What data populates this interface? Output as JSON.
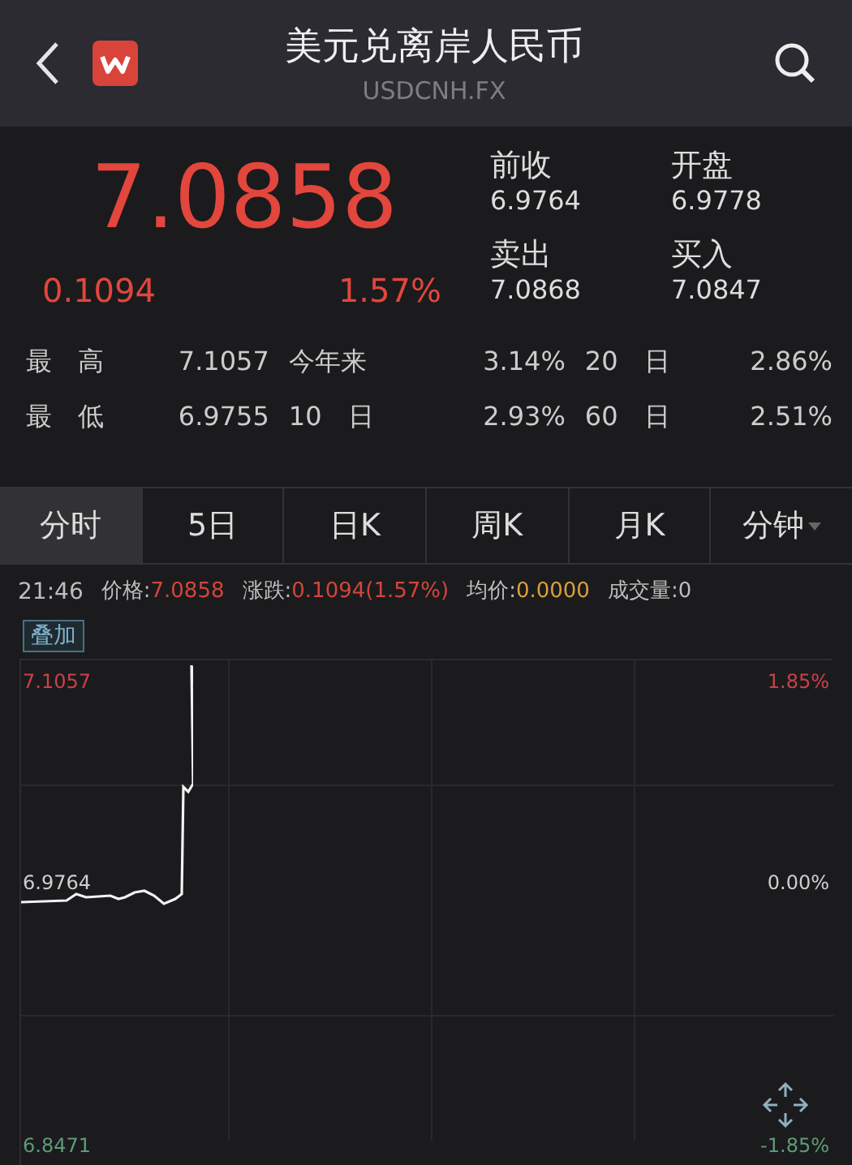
{
  "header": {
    "title": "美元兑离岸人民币",
    "subtitle": "USDCNH.FX"
  },
  "quote": {
    "price": "7.0858",
    "change": "0.1094",
    "change_pct": "1.57%",
    "fields": [
      {
        "label": "前收",
        "value": "6.9764"
      },
      {
        "label": "开盘",
        "value": "6.9778"
      },
      {
        "label": "卖出",
        "value": "7.0868"
      },
      {
        "label": "买入",
        "value": "7.0847"
      }
    ]
  },
  "stats": [
    [
      {
        "label": "最　高",
        "value": "7.1057"
      },
      {
        "label": "今年来",
        "value": "3.14%"
      },
      {
        "label": "20　日",
        "value": "2.86%"
      }
    ],
    [
      {
        "label": "最　低",
        "value": "6.9755"
      },
      {
        "label": "10　日",
        "value": "2.93%"
      },
      {
        "label": "60　日",
        "value": "2.51%"
      }
    ]
  ],
  "tabs": [
    {
      "label": "分时",
      "selected": true
    },
    {
      "label": "5日",
      "selected": false
    },
    {
      "label": "日K",
      "selected": false
    },
    {
      "label": "周K",
      "selected": false
    },
    {
      "label": "月K",
      "selected": false
    },
    {
      "label": "分钟",
      "selected": false,
      "dropdown": true
    }
  ],
  "info_bar": {
    "time": "21:46",
    "items": [
      {
        "label": "价格:",
        "value": "7.0858",
        "color": "#d2463c"
      },
      {
        "label": "涨跌:",
        "value": "0.1094(1.57%)",
        "color": "#d2463c"
      },
      {
        "label": "均价:",
        "value": "0.0000",
        "color": "#d9a13a"
      },
      {
        "label": "成交量:",
        "value": "0",
        "color": "#bdbdbd"
      }
    ]
  },
  "overlay_button": "叠加",
  "chart": {
    "left_labels": [
      {
        "text": "7.1057",
        "color": "#c9414a"
      },
      {
        "text": "6.9764",
        "color": "#cfcfcf"
      },
      {
        "text": "6.8471",
        "color": "#5f9a78"
      }
    ],
    "right_labels": [
      {
        "text": "1.85%",
        "color": "#c9414a"
      },
      {
        "text": "0.00%",
        "color": "#cfcfcf"
      },
      {
        "text": "-1.85%",
        "color": "#5f9a78"
      }
    ]
  }
}
